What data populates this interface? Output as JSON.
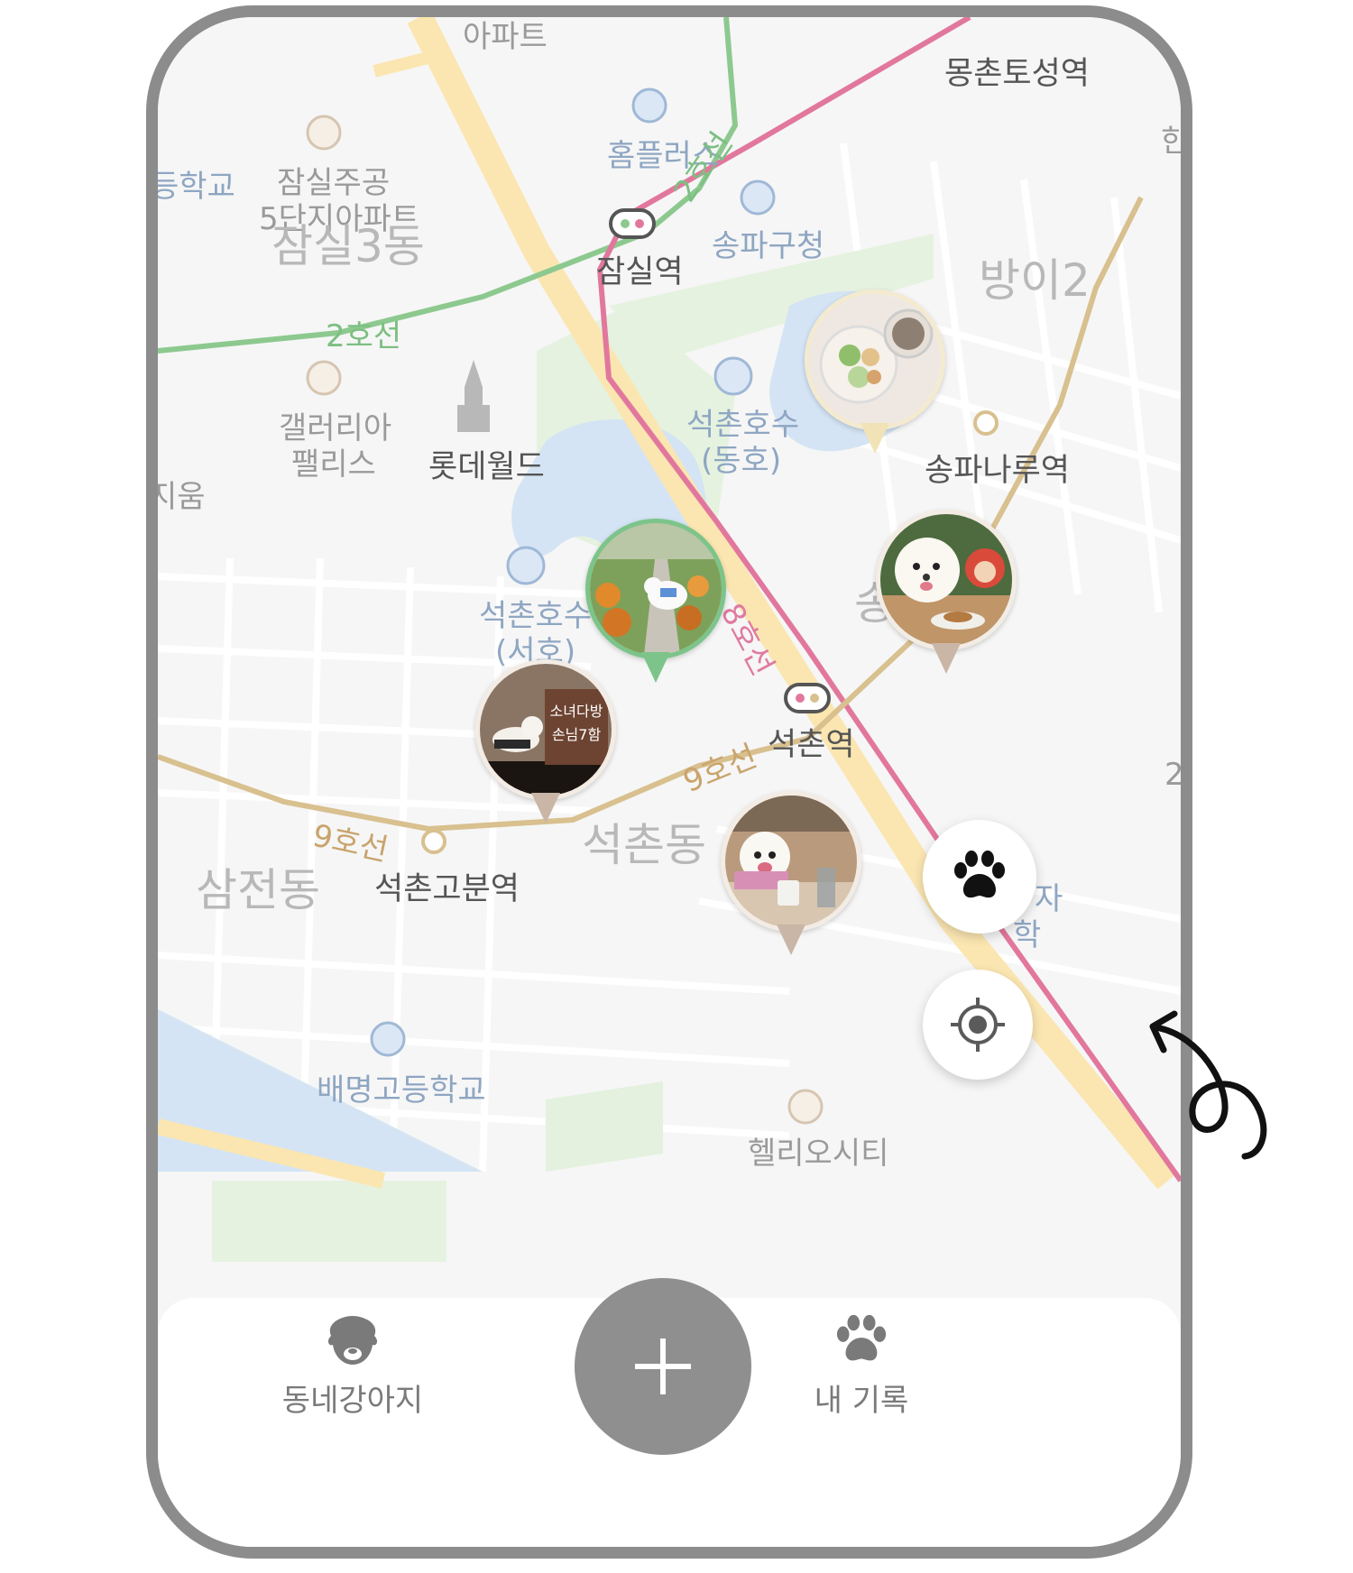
{
  "map": {
    "labels": {
      "apartment_top": "아파트",
      "mongchon": "몽촌토성역",
      "homeplus": "홈플러스",
      "school_left": "등학교",
      "jamsil_jugong": "잠실주공",
      "jugong_5": "5단지아파트",
      "jamsil3dong": "잠실3동",
      "line2_a": "2호선",
      "line2_b": "2호선",
      "jamsil_station": "잠실역",
      "songpa_gu": "송파구청",
      "bangi": "방이2",
      "galleria": "갤러리아",
      "palace": "팰리스",
      "lotte_world": "롯데월드",
      "seokchon_lake_east": "석촌호수",
      "east": "(동호)",
      "songpanaru": "송파나루역",
      "jium": "지움",
      "seokchon_lake_west": "석촌호수",
      "west": "(서호)",
      "line8": "8호선",
      "song": "송",
      "seokchon_station": "석촌역",
      "line9_a": "9호선",
      "line9_b": "9호선",
      "seokchon_dong": "석촌동",
      "samjeon_dong": "삼전동",
      "seokchon_gobun": "석촌고분역",
      "baemyeong": "배명고등학교",
      "helio": "헬리오시티",
      "han": "한",
      "ja": "자",
      "hak": "학",
      "two": "2"
    },
    "photo_markers": [
      {
        "name": "food-bowl",
        "color": "beige"
      },
      {
        "name": "dog-garden",
        "color": "green"
      },
      {
        "name": "dog-christmas",
        "color": "tan"
      },
      {
        "name": "dog-cafe-sign",
        "color": "tan",
        "sign": "소녀다방 손님7함"
      },
      {
        "name": "dog-cafe-table",
        "color": "tan"
      }
    ]
  },
  "buttons": {
    "paw_icon": "paw-icon",
    "location_icon": "crosshair-icon"
  },
  "tabbar": {
    "neighborhood_dogs": "동네강아지",
    "add_icon": "plus-icon",
    "my_records": "내 기록"
  },
  "colors": {
    "line2": "#8dc98f",
    "line8": "#e2779d",
    "line9": "#d8c08f",
    "water": "#d4e4f4",
    "park": "#e3f1de",
    "frame": "#8c8c8c",
    "add_button": "#8f8f8f"
  }
}
